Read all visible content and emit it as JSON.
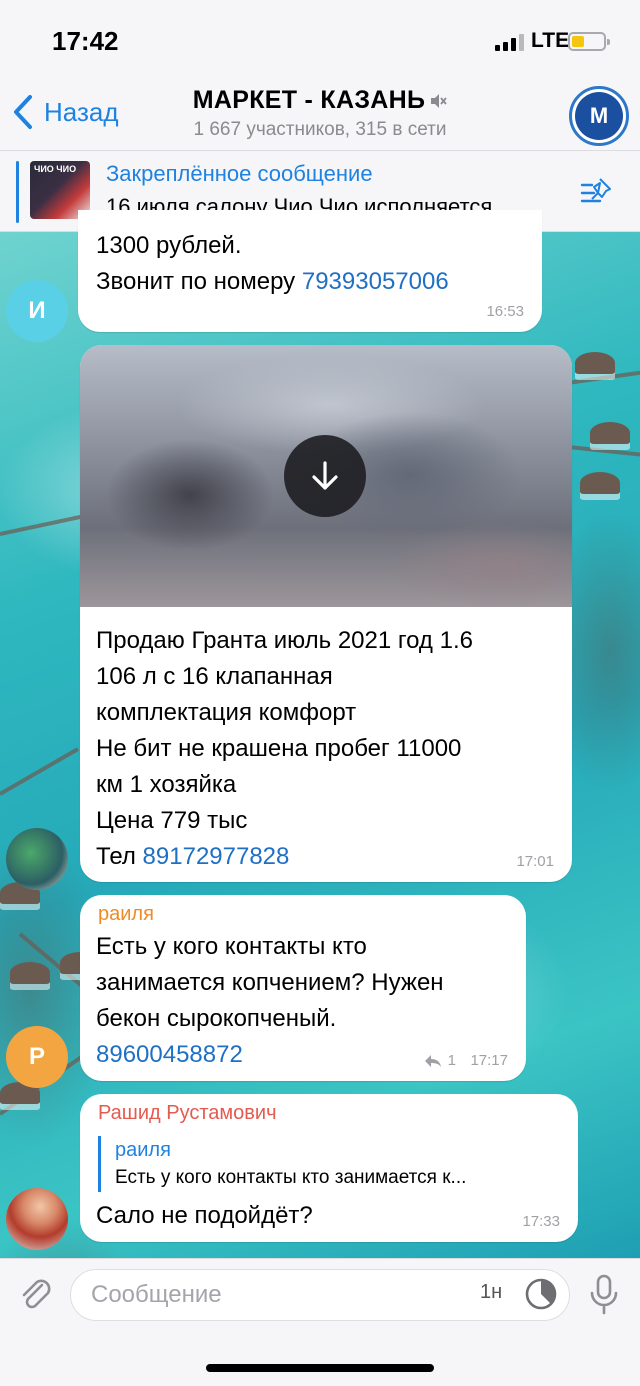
{
  "status_bar": {
    "time": "17:42",
    "network": "LTE"
  },
  "header": {
    "back_label": "Назад",
    "title": "МАРКЕТ - КАЗАНЬ",
    "subtitle": "1 667 участников, 315 в сети",
    "avatar_text": "М"
  },
  "pinned": {
    "title": "Закреплённое сообщение",
    "text": "16 июля салону Чио Чио исполняется…",
    "thumb_text": "ЧИО ЧИО"
  },
  "messages": [
    {
      "avatar_initial": "И",
      "avatar_color": "#5ad0e6",
      "lines": [
        "1300 рублей.",
        "Звонит по номеру "
      ],
      "link": "79393057006",
      "time": "16:53"
    },
    {
      "avatar_kind": "photo",
      "has_photo": true,
      "lines": [
        "Продаю Гранта июль 2021 год 1.6",
        "106 л с 16 клапанная",
        "комплектация комфорт",
        "Не бит не крашена пробег 11000",
        "км 1 хозяйка",
        "Цена 779 тыс",
        "Тел "
      ],
      "link": "89172977828",
      "time": "17:01"
    },
    {
      "avatar_initial": "Р",
      "avatar_color": "#f2a541",
      "sender": "раиля",
      "lines": [
        "Есть у кого контакты кто",
        "занимается копчением? Нужен",
        "бекон сырокопченый."
      ],
      "link": "89600458872",
      "replies": "1",
      "time": "17:17"
    },
    {
      "avatar_kind": "photo",
      "sender": "Рашид Рустамович",
      "reply_to_name": "раиля",
      "reply_to_text": "Есть у кого контакты кто занимается к...",
      "lines": [
        "Сало не подойдёт?"
      ],
      "time": "17:33"
    }
  ],
  "input": {
    "placeholder": "Сообщение",
    "timer_label": "1н"
  },
  "colors": {
    "accent": "#1f82e0",
    "link": "#1f6fc5",
    "sender_orange": "#f08a24",
    "sender_red": "#e55a4f"
  }
}
